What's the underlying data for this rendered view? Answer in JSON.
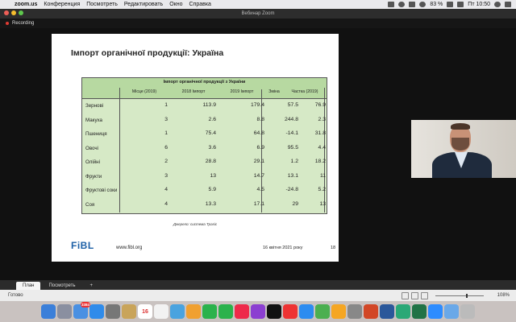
{
  "menubar": {
    "app": "zoom.us",
    "items": [
      "Конференция",
      "Посмотреть",
      "Редактировать",
      "Окно",
      "Справка"
    ],
    "battery": "83 %",
    "clock": "Пт 10:50"
  },
  "window": {
    "title": "Вебинар Zoom"
  },
  "recording": {
    "label": "Recording"
  },
  "slide": {
    "title": "Імпорт органічної продукції: Україна",
    "table": {
      "title": "Імпорт органічної продукції з України",
      "headers": [
        "Місце (2019)",
        "2018 Імпорт",
        "2019 Імпорт",
        "Зміна",
        "Частка (2019)"
      ],
      "rows": [
        {
          "name": "Зернові",
          "values": [
            "1",
            "113.9",
            "179.4",
            "57.5",
            "76.9"
          ]
        },
        {
          "name": "Макуха",
          "values": [
            "3",
            "2.6",
            "8.8",
            "244.8",
            "2.3"
          ]
        },
        {
          "name": "Пшениця",
          "values": [
            "1",
            "75.4",
            "64.8",
            "-14.1",
            "31.8"
          ]
        },
        {
          "name": "Овочі",
          "values": [
            "6",
            "3.6",
            "6.9",
            "95.5",
            "4.4"
          ]
        },
        {
          "name": "Олійні",
          "values": [
            "2",
            "28.8",
            "29.1",
            "1.2",
            "18.2"
          ]
        },
        {
          "name": "Фрукти",
          "values": [
            "3",
            "13",
            "14.7",
            "13.1",
            "11"
          ]
        },
        {
          "name": "Фруктові соки",
          "values": [
            "4",
            "5.9",
            "4.5",
            "-24.8",
            "5.2"
          ]
        },
        {
          "name": "Соя",
          "values": [
            "4",
            "13.3",
            "17.1",
            "29",
            "13"
          ]
        }
      ]
    },
    "caption": "Джерело: система Траsiс",
    "logo": "FiBL",
    "url": "www.fibl.org",
    "date": "16 квітня 2021 року",
    "page": "18"
  },
  "ppt": {
    "tabs": [
      "План",
      "Посмотреть",
      "+"
    ],
    "status": "Готово",
    "zoom": "108%"
  },
  "dock": {
    "mail_badge": "3384",
    "calendar_day": "16"
  }
}
